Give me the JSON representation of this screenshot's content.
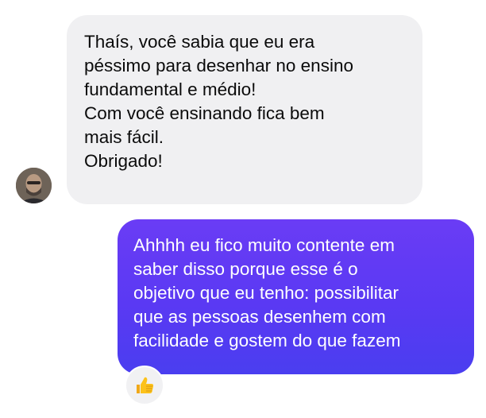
{
  "conversation": {
    "incoming": {
      "sender_avatar_icon": "user-avatar",
      "lines": [
        "Thaís, você sabia que eu era",
        "péssimo para desenhar no ensino",
        "fundamental e médio!",
        "Com você ensinando fica bem",
        "mais fácil.",
        "Obrigado!"
      ]
    },
    "outgoing": {
      "lines": [
        "Ahhhh eu fico muito contente em",
        "saber disso porque esse é o",
        "objetivo que eu tenho: possibilitar",
        "que as pessoas desenhem com",
        "facilidade e gostem do que fazem"
      ],
      "reaction_icon": "thumbs-up-icon"
    }
  },
  "colors": {
    "incoming_bubble": "#f0f0f2",
    "outgoing_bubble_top": "#6a3cf5",
    "outgoing_bubble_bottom": "#4a3ef0",
    "reaction_emoji": "#fcc21b"
  }
}
